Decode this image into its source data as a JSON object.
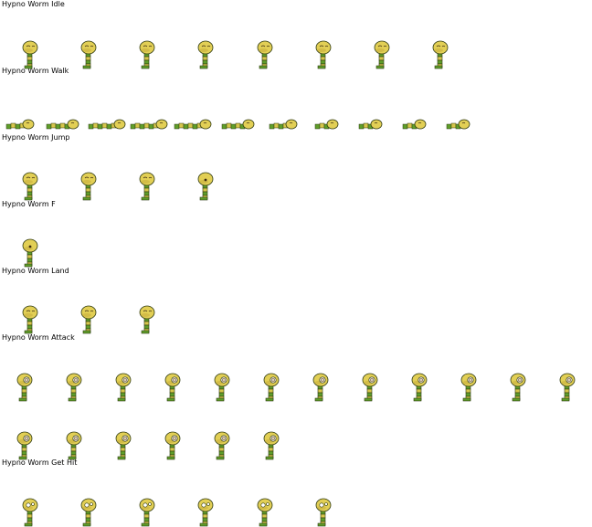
{
  "palette": {
    "head": "#e2cf55",
    "head_shade": "#c4a93a",
    "body_green": "#5f9e2a",
    "body_yellow": "#d6c64b",
    "outline": "#2f3a12",
    "eye": "#3a2a10",
    "spiral": "#6b4a1a"
  },
  "animations": [
    {
      "label": "Hypno Worm Idle",
      "pose": "stand",
      "count": 8,
      "variant": "idle"
    },
    {
      "label": "Hypno Worm Walk",
      "pose": "crawl",
      "count": 11,
      "variant": "walk"
    },
    {
      "label": "Hypno Worm Jump",
      "pose": "stand",
      "count": 4,
      "variant": "jump"
    },
    {
      "label": "Hypno Worm F",
      "pose": "stand",
      "count": 1,
      "variant": "fall"
    },
    {
      "label": "Hypno Worm Land",
      "pose": "stand",
      "count": 3,
      "variant": "land"
    },
    {
      "label": "Hypno Worm Attack",
      "pose": "stand",
      "count": 12,
      "variant": "attack"
    },
    {
      "label": "Hypno Worm Attack",
      "pose": "stand",
      "count": 6,
      "variant": "attack2",
      "continuation": true
    },
    {
      "label": "Hypno Worm Get Hit",
      "pose": "stand",
      "count": 6,
      "variant": "hit"
    }
  ]
}
